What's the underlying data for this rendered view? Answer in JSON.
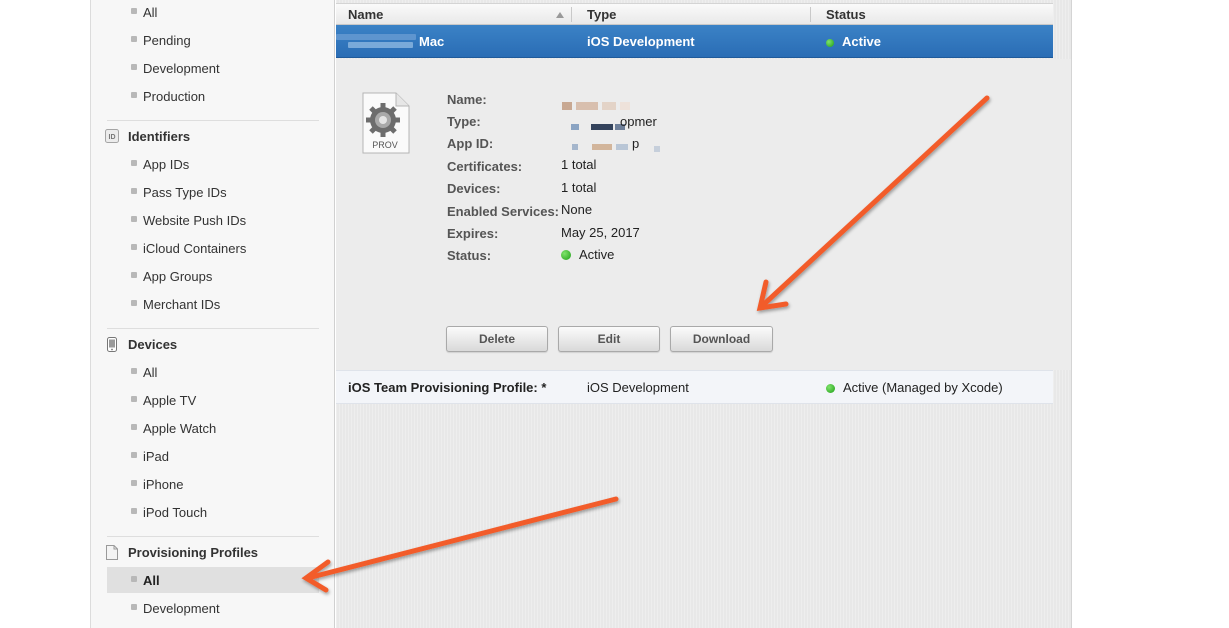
{
  "sidebar": {
    "top_items": [
      {
        "label": "All"
      },
      {
        "label": "Pending"
      },
      {
        "label": "Development"
      },
      {
        "label": "Production"
      }
    ],
    "identifiers": {
      "title": "Identifiers",
      "icon_text": "ID",
      "items": [
        {
          "label": "App IDs"
        },
        {
          "label": "Pass Type IDs"
        },
        {
          "label": "Website Push IDs"
        },
        {
          "label": "iCloud Containers"
        },
        {
          "label": "App Groups"
        },
        {
          "label": "Merchant IDs"
        }
      ]
    },
    "devices": {
      "title": "Devices",
      "items": [
        {
          "label": "All"
        },
        {
          "label": "Apple TV"
        },
        {
          "label": "Apple Watch"
        },
        {
          "label": "iPad"
        },
        {
          "label": "iPhone"
        },
        {
          "label": "iPod Touch"
        }
      ]
    },
    "profiles": {
      "title": "Provisioning Profiles",
      "items": [
        {
          "label": "All",
          "selected": true
        },
        {
          "label": "Development"
        }
      ]
    }
  },
  "table": {
    "headers": {
      "name": "Name",
      "type": "Type",
      "status": "Status"
    },
    "selected_row": {
      "name": "Mac",
      "type": "iOS Development",
      "status": "Active"
    },
    "row2": {
      "name": "iOS Team Provisioning Profile: *",
      "type": "iOS Development",
      "status": "Active (Managed by Xcode)"
    }
  },
  "details": {
    "icon_text": "PROV",
    "labels": {
      "name": "Name:",
      "type": "Type:",
      "app_id": "App ID:",
      "certificates": "Certificates:",
      "devices": "Devices:",
      "enabled_services": "Enabled Services:",
      "expires": "Expires:",
      "status": "Status:"
    },
    "values": {
      "type_fragment": "opmer",
      "app_id_fragment": "p",
      "certificates": "1 total",
      "devices": "1 total",
      "enabled_services": "None",
      "expires": "May 25, 2017",
      "status": "Active"
    },
    "buttons": {
      "delete": "Delete",
      "edit": "Edit",
      "download": "Download"
    }
  },
  "colors": {
    "selected_row": "#2e74bd",
    "status_green": "#2dbb22",
    "arrow": "#f25c2b"
  }
}
